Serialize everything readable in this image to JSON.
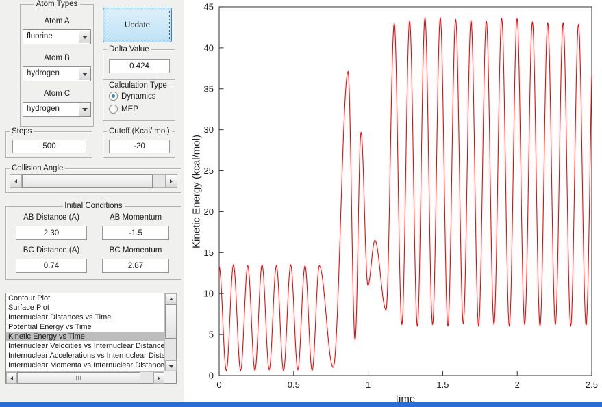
{
  "colors": {
    "window_bg": "#f0f0ee",
    "selection_gray": "#bdbdbd",
    "curve_red": "#ff0000",
    "bottom_bar_blue": "#2b6bd3",
    "button_fill_blue": "#cfe8f8",
    "button_border_blue": "#3f7fae"
  },
  "atom_types": {
    "title": "Atom Types",
    "atom_a_label": "Atom A",
    "atom_a_value": "fluorine",
    "atom_b_label": "Atom B",
    "atom_b_value": "hydrogen",
    "atom_c_label": "Atom C",
    "atom_c_value": "hydrogen"
  },
  "update_button": "Update",
  "delta": {
    "title": "Delta Value",
    "value": "0.424"
  },
  "calc_type": {
    "title": "Calculation Type",
    "options": [
      {
        "label": "Dynamics",
        "selected": true
      },
      {
        "label": "MEP",
        "selected": false
      }
    ]
  },
  "steps": {
    "title": "Steps",
    "value": "500"
  },
  "cutoff": {
    "title": "Cutoff (Kcal/ mol)",
    "value": "-20"
  },
  "collision_angle": {
    "label": "Collision Angle"
  },
  "initial_conditions": {
    "title": "Initial Conditions",
    "ab_distance_label": "AB Distance (A)",
    "ab_distance_value": "2.30",
    "ab_momentum_label": "AB Momentum",
    "ab_momentum_value": "-1.5",
    "bc_distance_label": "BC Distance (A)",
    "bc_distance_value": "0.74",
    "bc_momentum_label": "BC Momentum",
    "bc_momentum_value": "2.87"
  },
  "plot_list": {
    "items": [
      "Contour Plot",
      "Surface Plot",
      "Internuclear Distances vs Time",
      "Potential Energy vs Time",
      "Kinetic Energy vs Time",
      "Internuclear Velocities vs Internuclear Distance",
      "Internuclear Accelerations vs Internuclear Distance",
      "Internuclear Momenta vs Internuclear Distance"
    ],
    "selected_index": 4
  },
  "chart_data": {
    "type": "line",
    "title": "",
    "xlabel": "time",
    "ylabel": "Kinetic Energy (kcal/mol)",
    "xlim": [
      0,
      2.5
    ],
    "ylim": [
      0,
      45
    ],
    "x_ticks": [
      0,
      0.5,
      1,
      1.5,
      2,
      2.5
    ],
    "x_tick_labels": [
      "0",
      "0.5",
      "1",
      "1.5",
      "2",
      "2.5"
    ],
    "y_ticks": [
      0,
      5,
      10,
      15,
      20,
      25,
      30,
      35,
      40,
      45
    ],
    "line_color": "#ff0000",
    "interpolation": "half-cosine between consecutive extrema",
    "extrema": [
      [
        0.0,
        13.3
      ],
      [
        0.048,
        0.6
      ],
      [
        0.096,
        13.5
      ],
      [
        0.144,
        0.6
      ],
      [
        0.192,
        13.4
      ],
      [
        0.24,
        0.6
      ],
      [
        0.288,
        13.5
      ],
      [
        0.336,
        0.7
      ],
      [
        0.384,
        13.4
      ],
      [
        0.432,
        0.6
      ],
      [
        0.48,
        13.5
      ],
      [
        0.528,
        0.7
      ],
      [
        0.576,
        13.4
      ],
      [
        0.624,
        0.6
      ],
      [
        0.672,
        13.4
      ],
      [
        0.765,
        1.0
      ],
      [
        0.865,
        37.1
      ],
      [
        0.912,
        4.3
      ],
      [
        0.952,
        29.7
      ],
      [
        0.998,
        11.0
      ],
      [
        1.045,
        16.5
      ],
      [
        1.12,
        8.0
      ],
      [
        1.175,
        43.0
      ],
      [
        1.226,
        6.2
      ],
      [
        1.278,
        43.3
      ],
      [
        1.33,
        6.0
      ],
      [
        1.381,
        43.7
      ],
      [
        1.432,
        6.2
      ],
      [
        1.484,
        43.7
      ],
      [
        1.535,
        6.0
      ],
      [
        1.587,
        43.5
      ],
      [
        1.638,
        6.3
      ],
      [
        1.69,
        43.4
      ],
      [
        1.741,
        6.0
      ],
      [
        1.793,
        43.3
      ],
      [
        1.844,
        6.2
      ],
      [
        1.896,
        43.6
      ],
      [
        1.947,
        6.0
      ],
      [
        1.999,
        43.6
      ],
      [
        2.05,
        6.2
      ],
      [
        2.102,
        43.2
      ],
      [
        2.153,
        6.0
      ],
      [
        2.205,
        43.1
      ],
      [
        2.256,
        6.2
      ],
      [
        2.308,
        43.1
      ],
      [
        2.359,
        6.0
      ],
      [
        2.411,
        42.9
      ],
      [
        2.462,
        6.1
      ],
      [
        2.514,
        43.0
      ]
    ]
  }
}
